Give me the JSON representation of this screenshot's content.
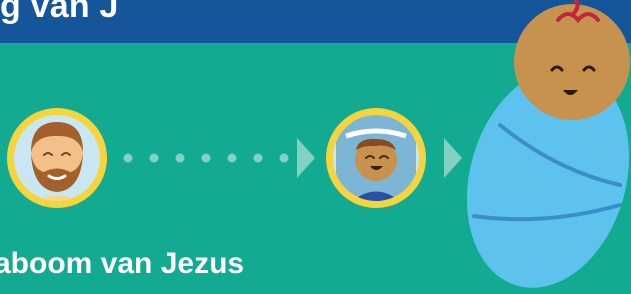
{
  "banner": {
    "title": "g van J"
  },
  "timeline": {
    "subtitle": "aboom van Jezus",
    "dot_count": 7
  },
  "characters": [
    {
      "name": "bearded-man",
      "icon": "bearded-man-avatar-icon"
    },
    {
      "name": "woman-headscarf",
      "icon": "woman-headscarf-avatar-icon"
    },
    {
      "name": "swaddled-baby",
      "icon": "swaddled-baby-icon"
    }
  ],
  "colors": {
    "background": "#12ab91",
    "banner": "#15559a",
    "avatar_ring": "#f7d33c",
    "avatar_fill": "#c9e7f2",
    "swaddle": "#5ec2ef",
    "swaddle_line": "#3a8fc8",
    "skin": "#c6924d",
    "dots": "#82d2c4"
  }
}
